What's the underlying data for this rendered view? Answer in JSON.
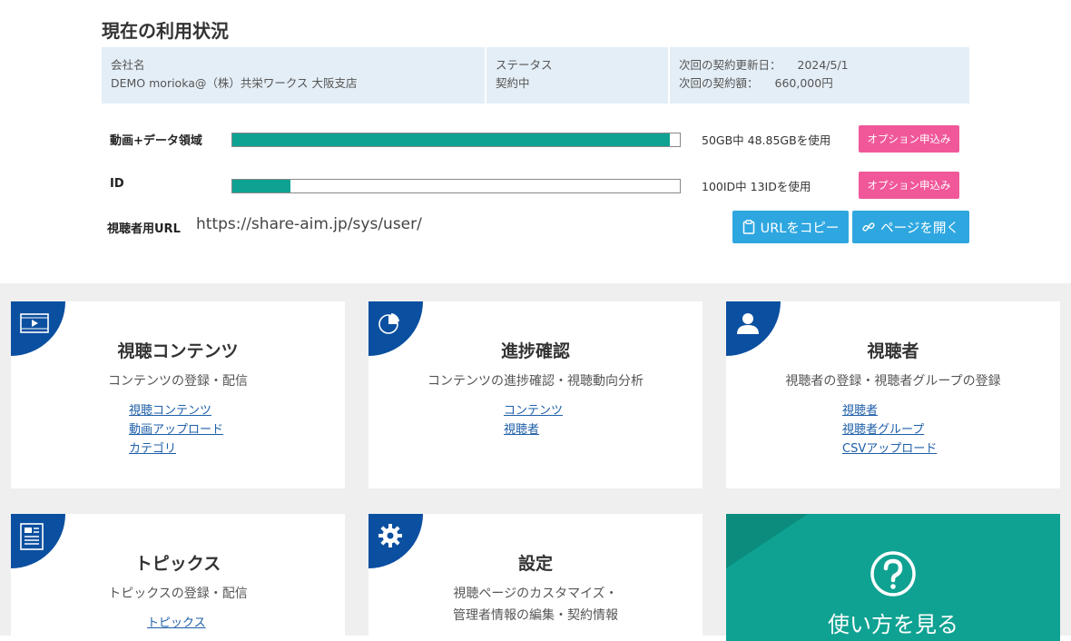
{
  "header": {
    "title": "現在の利用状況"
  },
  "info": {
    "company_label": "会社名",
    "company_value": "DEMO morioka@（株）共栄ワークス 大阪支店",
    "status_label": "ステータス",
    "status_value": "契約中",
    "renewal_label": "次回の契約更新日：",
    "renewal_value": "2024/5/1",
    "amount_label": "次回の契約額：",
    "amount_value": "660,000円"
  },
  "usage": [
    {
      "label": "動画+データ領域",
      "text": "50GB中 48.85GBを使用",
      "fraction": 0.977,
      "button": "オプション申込み"
    },
    {
      "label": "ID",
      "text": "100ID中 13IDを使用",
      "fraction": 0.13,
      "button": "オプション申込み"
    }
  ],
  "viewer_url": {
    "label": "視聴者用URL",
    "value": "https://share-aim.jp/sys/user/",
    "copy_button": "URLをコピー",
    "open_button": "ページを開く"
  },
  "cards": [
    {
      "title": "視聴コンテンツ",
      "desc": "コンテンツの登録・配信",
      "links": [
        "視聴コンテンツ",
        "動画アップロード",
        "カテゴリ"
      ],
      "icon": "video-icon"
    },
    {
      "title": "進捗確認",
      "desc": "コンテンツの進捗確認・視聴動向分析",
      "links": [
        "コンテンツ",
        "視聴者"
      ],
      "icon": "pie-chart-icon"
    },
    {
      "title": "視聴者",
      "desc": "視聴者の登録・視聴者グループの登録",
      "links": [
        "視聴者",
        "視聴者グループ",
        "CSVアップロード"
      ],
      "icon": "user-icon"
    },
    {
      "title": "トピックス",
      "desc": "トピックスの登録・配信",
      "links": [
        "トピックス"
      ],
      "icon": "news-icon"
    },
    {
      "title": "設定",
      "desc_line1": "視聴ページのカスタマイズ・",
      "desc_line2": "管理者情報の編集・契約情報",
      "icon": "gear-icon"
    }
  ],
  "help": {
    "title": "使い方を見る",
    "icon": "question-icon"
  },
  "colors": {
    "accent_teal": "#0fa292",
    "pink": "#f0589a",
    "blue_button": "#2ea7e0",
    "corner_blue": "#0b4fa0"
  }
}
